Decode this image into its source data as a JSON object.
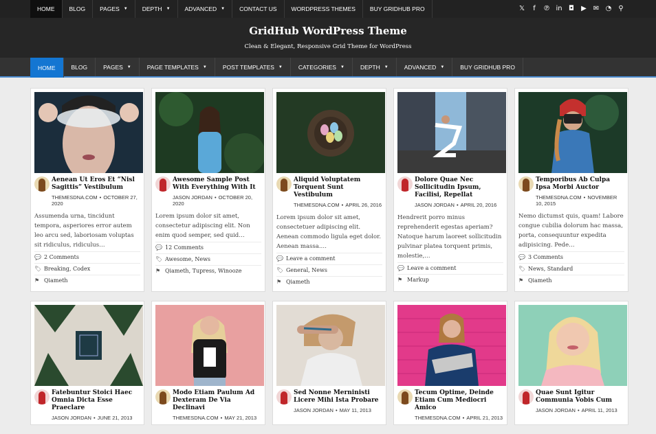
{
  "topnav": [
    {
      "label": "Home",
      "active": true,
      "caret": false
    },
    {
      "label": "Blog",
      "caret": false
    },
    {
      "label": "Pages",
      "caret": true
    },
    {
      "label": "Depth",
      "caret": true
    },
    {
      "label": "Advanced",
      "caret": true
    },
    {
      "label": "Contact Us",
      "caret": false
    },
    {
      "label": "WordPress Themes",
      "caret": false
    },
    {
      "label": "Buy GridHub Pro",
      "caret": false
    }
  ],
  "social": [
    {
      "name": "twitter-icon",
      "glyph": "𝕏"
    },
    {
      "name": "facebook-icon",
      "glyph": "f"
    },
    {
      "name": "pinterest-icon",
      "glyph": "℗"
    },
    {
      "name": "linkedin-icon",
      "glyph": "in"
    },
    {
      "name": "instagram-icon",
      "glyph": "◘"
    },
    {
      "name": "youtube-icon",
      "glyph": "▶"
    },
    {
      "name": "email-icon",
      "glyph": "✉"
    },
    {
      "name": "rss-icon",
      "glyph": "◔"
    },
    {
      "name": "search-icon",
      "glyph": "⚲"
    }
  ],
  "site": {
    "title": "GridHub WordPress Theme",
    "tagline": "Clean & Elegant, Responsive Grid Theme for WordPress"
  },
  "mainnav": [
    {
      "label": "Home",
      "active": true,
      "caret": false
    },
    {
      "label": "Blog",
      "caret": false
    },
    {
      "label": "Pages",
      "caret": true
    },
    {
      "label": "Page Templates",
      "caret": true
    },
    {
      "label": "Post Templates",
      "caret": true
    },
    {
      "label": "Categories",
      "caret": true
    },
    {
      "label": "Depth",
      "caret": true
    },
    {
      "label": "Advanced",
      "caret": true
    },
    {
      "label": "Buy GridHub Pro",
      "caret": false
    }
  ],
  "posts": [
    {
      "title": "Aenean Ut Eros Et “Nisl Sagittis” Vestibulum",
      "author": "THEMESDNA.COM",
      "date": "OCTOBER 27, 2020",
      "avatar": "b1",
      "excerpt": "Assumenda urna, tincidunt tempora, asperiores error autem leo arcu sed, laboriosam voluptas sit ridiculus, ridiculus…",
      "comments": "2 Comments",
      "tags": "Breaking, Codex",
      "cat": "Qiameth",
      "img": "mask"
    },
    {
      "title": "Awesome Sample Post With Everything With It",
      "author": "JASON JORDAN",
      "date": "OCTOBER 20, 2020",
      "avatar": "b2",
      "excerpt": "Lorem ipsum dolor sit amet, consectetur adipiscing elit. Non enim quod semper, sed quid…",
      "comments": "12 Comments",
      "tags": "Awesome, News",
      "cat": "Qiameth, Tupress, Winooze",
      "img": "forest"
    },
    {
      "title": "Aliquid Voluptatem Torquent Sunt Vestibulum",
      "author": "THEMESDNA.COM",
      "date": "APRIL 26, 2016",
      "avatar": "b1",
      "excerpt": "Lorem ipsum dolor sit amet, consectetuer adipiscing elit. Aenean commodo ligula eget dolor. Aenean massa.…",
      "comments": "Leave a comment",
      "tags": "General, News",
      "cat": "Qiameth",
      "img": "nest"
    },
    {
      "title": "Dolore Quae Nec Sollicitudin Ipsum, Facilisi, Repellat",
      "author": "JASON JORDAN",
      "date": "APRIL 20, 2016",
      "avatar": "b2",
      "excerpt": "Hendrerit porro minus reprehenderit egestas aperiam? Natoque harum laoreet sollicitudin pulvinar platea torquent primis, molestie,…",
      "comments": "Leave a comment",
      "tags": "",
      "cat": "Markup",
      "img": "city"
    },
    {
      "title": "Temporibus Ab Culpa Ipsa Morbi Auctor",
      "author": "THEMESDNA.COM",
      "date": "NOVEMBER 10, 2015",
      "avatar": "b1",
      "excerpt": "Nemo dictumst quis, quam! Labore congue cubilia dolorum hac massa, porta, consequuntur expedita adipisicing. Pede…",
      "comments": "3 Comments",
      "tags": "News, Standard",
      "cat": "Qiameth",
      "img": "camera"
    },
    {
      "title": "Fatebuntur Stoici Haec Omnia Dicta Esse Praeclare",
      "author": "JASON JORDAN",
      "date": "JUNE 21, 2013",
      "avatar": "b2",
      "img": "pine"
    },
    {
      "title": "Modo Etiam Paulum Ad Dexteram De Via Declinavi",
      "author": "THEMESDNA.COM",
      "date": "MAY 21, 2013",
      "avatar": "b1",
      "img": "pinkwall"
    },
    {
      "title": "Sed Nonne Merninisti Licere Mihi Ista Probare",
      "author": "JASON JORDAN",
      "date": "MAY 11, 2013",
      "avatar": "b2",
      "img": "tattoo"
    },
    {
      "title": "Tecum Optime, Deinde Etiam Cum Mediocri Amico",
      "author": "THEMESDNA.COM",
      "date": "APRIL 21, 2013",
      "avatar": "b1",
      "img": "magenta"
    },
    {
      "title": "Quae Sunt Igitur Communia Vobis Cum",
      "author": "JASON JORDAN",
      "date": "APRIL 11, 2013",
      "avatar": "b2",
      "img": "blonde"
    }
  ]
}
